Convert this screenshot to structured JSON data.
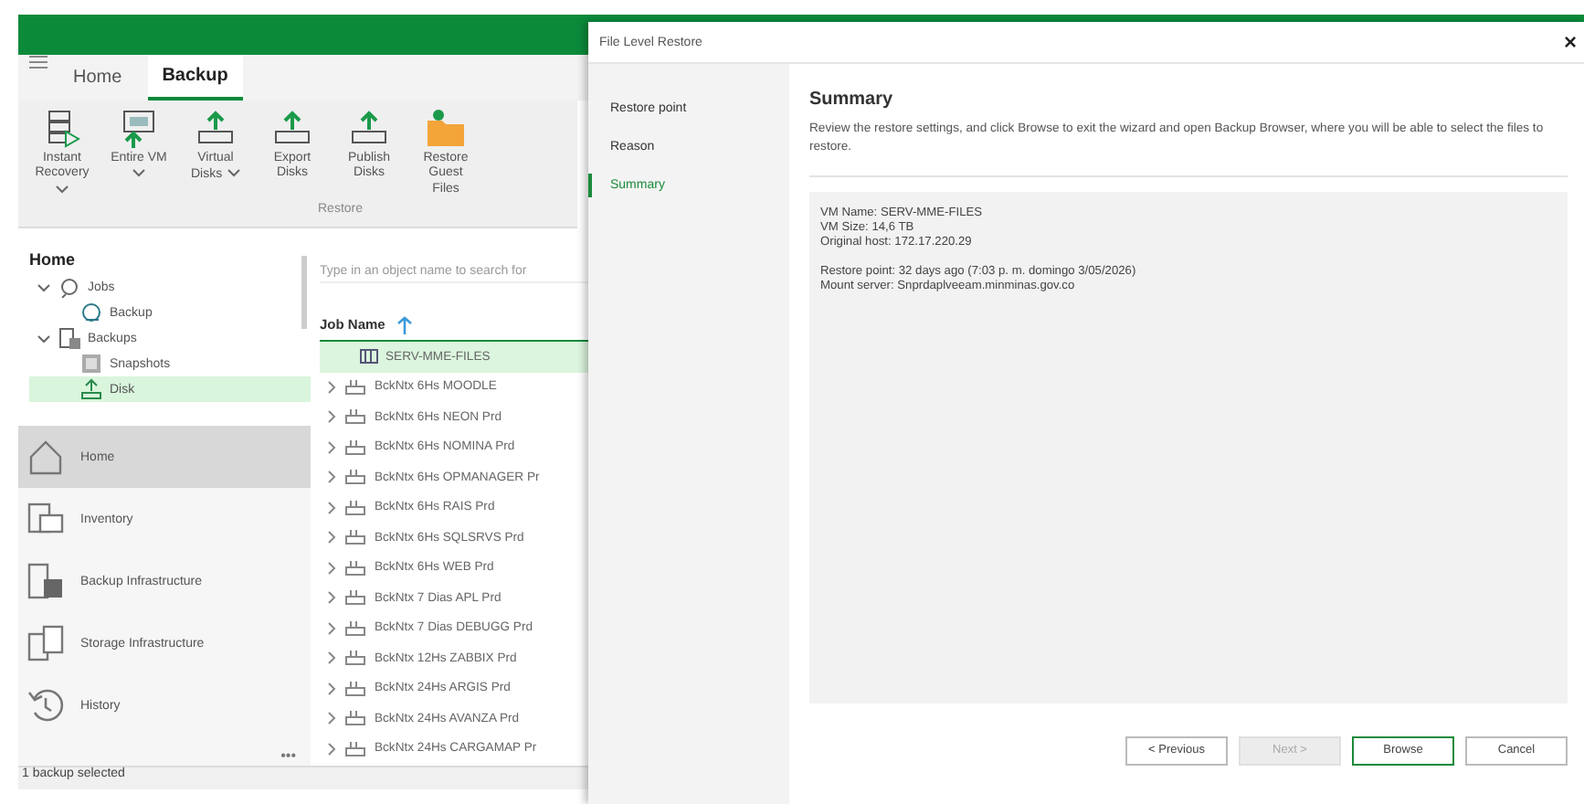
{
  "app": {
    "tabs": [
      {
        "label": "Home",
        "selected": false
      },
      {
        "label": "Backup",
        "selected": true
      }
    ],
    "ribbon": {
      "buttons": [
        {
          "label": "Instant Recovery",
          "dropdown": true,
          "kind": "server"
        },
        {
          "label": "Entire VM",
          "dropdown": true,
          "kind": "vm"
        },
        {
          "label": "Virtual Disks",
          "dropdown": true,
          "kind": "disk"
        },
        {
          "label": "Export Disks",
          "dropdown": false,
          "kind": "disk"
        },
        {
          "label": "Publish Disks",
          "dropdown": false,
          "kind": "disk"
        },
        {
          "label": "Restore Guest Files",
          "dropdown": false,
          "kind": "folder"
        }
      ],
      "group_label": "Restore"
    },
    "tree": {
      "title": "Home",
      "items": [
        {
          "label": "Jobs",
          "kind": "jobs",
          "expanded": true,
          "selected": false,
          "children": [
            {
              "label": "Backup",
              "kind": "backup",
              "selected": false
            }
          ]
        },
        {
          "label": "Backups",
          "kind": "backups",
          "expanded": true,
          "selected": false,
          "children": [
            {
              "label": "Snapshots",
              "kind": "snapshots",
              "selected": false
            },
            {
              "label": "Disk",
              "kind": "disk",
              "selected": true
            }
          ]
        }
      ]
    },
    "nav": [
      {
        "label": "Home",
        "kind": "home",
        "selected": true
      },
      {
        "label": "Inventory",
        "kind": "inventory",
        "selected": false
      },
      {
        "label": "Backup Infrastructure",
        "kind": "backup",
        "selected": false
      },
      {
        "label": "Storage Infrastructure",
        "kind": "storage",
        "selected": false
      },
      {
        "label": "History",
        "kind": "history",
        "selected": false
      }
    ],
    "nav_more": "•••",
    "search": {
      "placeholder": "Type in an object name to search for"
    },
    "table": {
      "columns": [
        "Job Name"
      ],
      "rows": [
        {
          "name": "SERV-MME-FILES",
          "kind": "vm",
          "selected": true
        },
        {
          "name": "BckNtx 6Hs MOODLE",
          "kind": "job",
          "selected": false
        },
        {
          "name": "BckNtx 6Hs NEON Prd",
          "kind": "job",
          "selected": false
        },
        {
          "name": "BckNtx 6Hs NOMINA Prd",
          "kind": "job",
          "selected": false
        },
        {
          "name": "BckNtx 6Hs OPMANAGER Pr",
          "kind": "job",
          "selected": false
        },
        {
          "name": "BckNtx 6Hs RAIS Prd",
          "kind": "job",
          "selected": false
        },
        {
          "name": "BckNtx 6Hs SQLSRVS Prd",
          "kind": "job",
          "selected": false
        },
        {
          "name": "BckNtx 6Hs WEB Prd",
          "kind": "job",
          "selected": false
        },
        {
          "name": "BckNtx 7 Dias APL Prd",
          "kind": "job",
          "selected": false
        },
        {
          "name": "BckNtx 7 Dias DEBUGG Prd",
          "kind": "job",
          "selected": false
        },
        {
          "name": "BckNtx 12Hs ZABBIX Prd",
          "kind": "job",
          "selected": false
        },
        {
          "name": "BckNtx 24Hs ARGIS Prd",
          "kind": "job",
          "selected": false
        },
        {
          "name": "BckNtx 24Hs AVANZA Prd",
          "kind": "job",
          "selected": false
        },
        {
          "name": "BckNtx 24Hs CARGAMAP Pr",
          "kind": "job",
          "selected": false
        }
      ]
    },
    "status_bar": "1 backup selected"
  },
  "dialog": {
    "title": "File Level Restore",
    "close": "×",
    "steps": [
      {
        "label": "Restore point",
        "selected": false
      },
      {
        "label": "Reason",
        "selected": false
      },
      {
        "label": "Summary",
        "selected": true
      }
    ],
    "heading": "Summary",
    "description": "Review the restore settings, and click Browse to exit the wizard and open Backup Browser, where you will be able to select the files to restore.",
    "summary": [
      [
        "VM Name: SERV-MME-FILES",
        "VM Size: 14,6 TB",
        "Original host: 172.17.220.29"
      ],
      [
        "Restore point: 32 days ago (7:03 p. m. domingo 3/05/2026)",
        "Mount server: Snprdaplveeam.minminas.gov.co"
      ]
    ],
    "buttons": [
      {
        "label": "< Previous",
        "disabled": false,
        "default": false
      },
      {
        "label": "Next >",
        "disabled": true,
        "default": false
      },
      {
        "label": "Browse",
        "disabled": false,
        "default": true
      },
      {
        "label": "Cancel",
        "disabled": false,
        "default": false
      }
    ]
  }
}
